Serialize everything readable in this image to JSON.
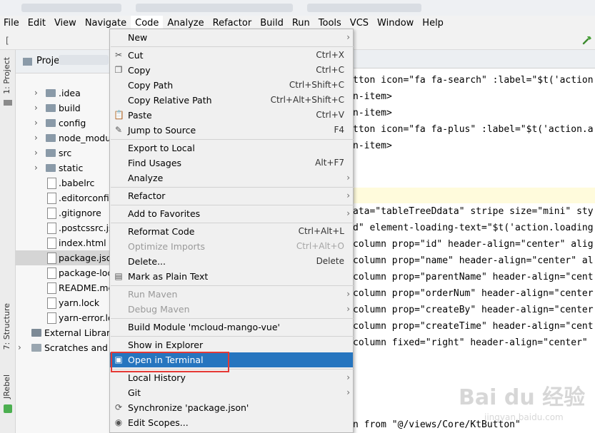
{
  "menubar": [
    "File",
    "Edit",
    "View",
    "Navigate",
    "Code",
    "Analyze",
    "Refactor",
    "Build",
    "Run",
    "Tools",
    "VCS",
    "Window",
    "Help"
  ],
  "toolbar": {
    "left_text": "["
  },
  "side_labels": {
    "project": "1: Project",
    "structure": "7: Structure",
    "jrebel": "JRebel"
  },
  "project_panel": {
    "title": "Project",
    "rows": [
      {
        "label": ".idea",
        "kind": "folder",
        "chevron": "›"
      },
      {
        "label": "build",
        "kind": "folder",
        "chevron": "›"
      },
      {
        "label": "config",
        "kind": "folder",
        "chevron": "›"
      },
      {
        "label": "node_modul",
        "kind": "folder",
        "chevron": "›"
      },
      {
        "label": "src",
        "kind": "folder",
        "chevron": "›"
      },
      {
        "label": "static",
        "kind": "folder",
        "chevron": "›"
      },
      {
        "label": ".babelrc",
        "kind": "file"
      },
      {
        "label": ".editorconfig",
        "kind": "file"
      },
      {
        "label": ".gitignore",
        "kind": "file"
      },
      {
        "label": ".postcssrc.js",
        "kind": "file"
      },
      {
        "label": "index.html",
        "kind": "file"
      },
      {
        "label": "package.json",
        "kind": "file",
        "selected": true
      },
      {
        "label": "package-lock",
        "kind": "file"
      },
      {
        "label": "README.md",
        "kind": "file"
      },
      {
        "label": "yarn.lock",
        "kind": "file"
      },
      {
        "label": "yarn-error.lo",
        "kind": "file"
      },
      {
        "label": "External Librarie",
        "kind": "lib"
      },
      {
        "label": "Scratches and C",
        "kind": "scratch"
      }
    ]
  },
  "editor": {
    "lines": [
      "tton icon=\"fa fa-search\" :label=\"$t('action",
      "n-item>",
      "n-item>",
      "tton icon=\"fa fa-plus\" :label=\"$t('action.a",
      "n-item>",
      "",
      "",
      "",
      "ata=\"tableTreeDdata\" stripe size=\"mini\" sty",
      "d\" element-loading-text=\"$t('action.loading",
      "column prop=\"id\" header-align=\"center\" alig",
      "column prop=\"name\" header-align=\"center\" al",
      "column prop=\"parentName\" header-align=\"cent",
      "column prop=\"orderNum\" header-align=\"center",
      "column prop=\"createBy\" header-align=\"center",
      "column prop=\"createTime\" header-align=\"cent",
      "column fixed=\"right\" header-align=\"center\"",
      "n from \"@/views/Core/KtButton\""
    ]
  },
  "context_menu": {
    "items": [
      {
        "label": "New",
        "shortcut": "",
        "arrow": true
      },
      {
        "sep": true
      },
      {
        "label": "Cut",
        "shortcut": "Ctrl+X",
        "icon": "✂",
        "icon_name": "cut-icon"
      },
      {
        "label": "Copy",
        "shortcut": "Ctrl+C",
        "icon": "❐",
        "icon_name": "copy-icon"
      },
      {
        "label": "Copy Path",
        "shortcut": "Ctrl+Shift+C"
      },
      {
        "label": "Copy Relative Path",
        "shortcut": "Ctrl+Alt+Shift+C"
      },
      {
        "label": "Paste",
        "shortcut": "Ctrl+V",
        "icon": "📋",
        "icon_name": "paste-icon"
      },
      {
        "label": "Jump to Source",
        "shortcut": "F4",
        "icon": "✎",
        "icon_name": "jump-to-source-icon"
      },
      {
        "sep": true
      },
      {
        "label": "Export to Local",
        "shortcut": ""
      },
      {
        "label": "Find Usages",
        "shortcut": "Alt+F7"
      },
      {
        "label": "Analyze",
        "shortcut": "",
        "arrow": true
      },
      {
        "sep": true
      },
      {
        "label": "Refactor",
        "shortcut": "",
        "arrow": true
      },
      {
        "sep": true
      },
      {
        "label": "Add to Favorites",
        "shortcut": "",
        "arrow": true
      },
      {
        "sep": true
      },
      {
        "label": "Reformat Code",
        "shortcut": "Ctrl+Alt+L"
      },
      {
        "label": "Optimize Imports",
        "shortcut": "Ctrl+Alt+O",
        "disabled": true
      },
      {
        "label": "Delete...",
        "shortcut": "Delete"
      },
      {
        "label": "Mark as Plain Text",
        "shortcut": "",
        "icon": "▤",
        "icon_name": "plain-text-icon"
      },
      {
        "sep": true
      },
      {
        "label": "Run Maven",
        "shortcut": "",
        "arrow": true,
        "disabled": true
      },
      {
        "label": "Debug Maven",
        "shortcut": "",
        "arrow": true,
        "disabled": true
      },
      {
        "sep": true
      },
      {
        "label": "Build Module 'mcloud-mango-vue'",
        "shortcut": ""
      },
      {
        "sep": true
      },
      {
        "label": "Show in Explorer",
        "shortcut": ""
      },
      {
        "label": "Open in Terminal",
        "shortcut": "",
        "selected": true,
        "icon": "▣",
        "icon_name": "terminal-icon"
      },
      {
        "sep": true
      },
      {
        "label": "Local History",
        "shortcut": "",
        "arrow": true
      },
      {
        "label": "Git",
        "shortcut": "",
        "arrow": true
      },
      {
        "label": "Synchronize 'package.json'",
        "shortcut": "",
        "icon": "⟳",
        "icon_name": "synchronize-icon"
      },
      {
        "label": "Edit Scopes...",
        "shortcut": "",
        "icon": "◉",
        "icon_name": "edit-scopes-icon"
      }
    ]
  },
  "watermark": {
    "brand": "Bai du 经验",
    "url": "jingyan.baidu.com"
  },
  "colors": {
    "selection": "#2675bf",
    "highlight_box": "#e53935",
    "menu_bg": "#f0f0f0"
  }
}
